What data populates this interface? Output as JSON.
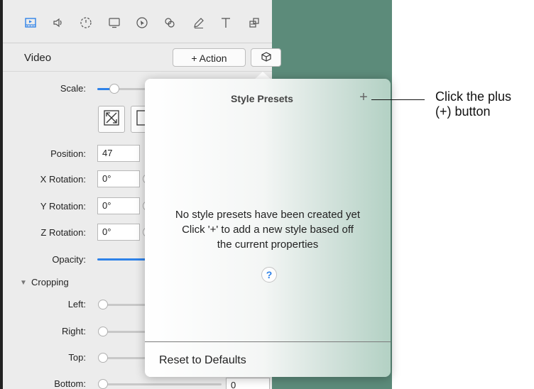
{
  "toolbar": {
    "icons": [
      "video-icon",
      "audio-icon",
      "timing-icon",
      "display-icon",
      "cursor-icon",
      "link-icon",
      "pen-icon",
      "text-icon",
      "layers-icon"
    ]
  },
  "header": {
    "title": "Video",
    "action_label": "+ Action",
    "presets_icon": "cube-icon"
  },
  "properties": {
    "scale_label": "Scale:",
    "position_label": "Position:",
    "position_value": "47",
    "x_rotation_label": "X Rotation:",
    "x_rotation_value": "0°",
    "y_rotation_label": "Y Rotation:",
    "y_rotation_value": "0°",
    "z_rotation_label": "Z Rotation:",
    "z_rotation_value": "0°",
    "opacity_label": "Opacity:"
  },
  "cropping": {
    "header": "Cropping",
    "left_label": "Left:",
    "right_label": "Right:",
    "top_label": "Top:",
    "bottom_label": "Bottom:",
    "bottom_value": "0"
  },
  "popover": {
    "title": "Style Presets",
    "plus_label": "+",
    "empty_line1": "No style presets have been created yet",
    "empty_line2": "Click '+' to add a new style based off",
    "empty_line3": "the current properties",
    "help_label": "?",
    "reset_label": "Reset to Defaults"
  },
  "callout": {
    "line1": "Click the plus",
    "line2": "(+) button"
  },
  "colors": {
    "accent": "#2f82e8",
    "backdrop": "#5c8b7a",
    "panel": "#ececec"
  }
}
